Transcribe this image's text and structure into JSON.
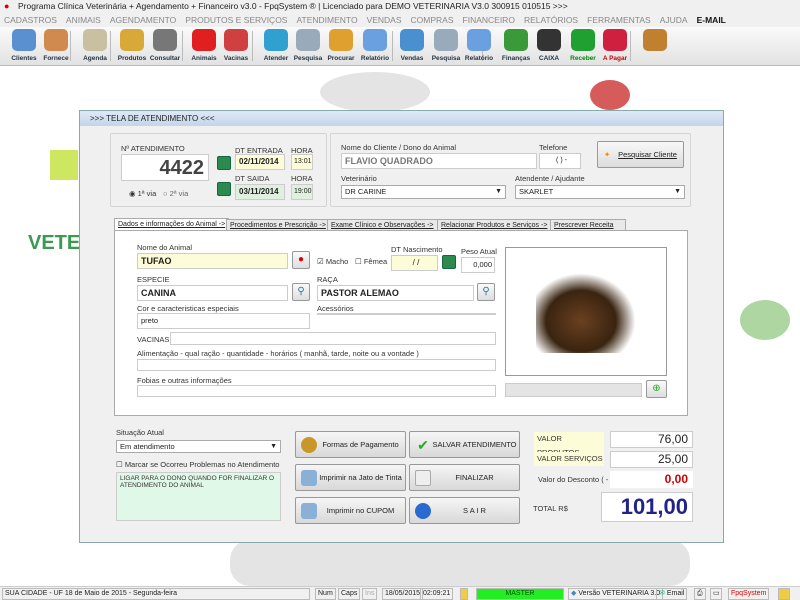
{
  "window": {
    "title": "Programa Clínica Veterinária + Agendamento + Financeiro v3.0 - FpqSystem ® | Licenciado para  DEMO VETERINARIA V3.0 300915 010515 >>>"
  },
  "menu": [
    "CADASTROS",
    "ANIMAIS",
    "AGENDAMENTO",
    "PRODUTOS E SERVIÇOS",
    "ATENDIMENTO",
    "VENDAS",
    "COMPRAS",
    "FINANCEIRO",
    "RELATÓRIOS",
    "FERRAMENTAS",
    "AJUDA",
    "E-MAIL"
  ],
  "toolbar": [
    {
      "label": "Clientes",
      "color": "#5a8fd0"
    },
    {
      "label": "Fornece",
      "color": "#d08a50"
    },
    {
      "label": "Agenda",
      "color": "#c8c0a0"
    },
    {
      "label": "Produtos",
      "color": "#d8a838"
    },
    {
      "label": "Consultar",
      "color": "#777"
    },
    {
      "label": "Animais",
      "color": "#e02020"
    },
    {
      "label": "Vacinas",
      "color": "#d04040"
    },
    {
      "label": "Atender",
      "color": "#30a0d0"
    },
    {
      "label": "Pesquisa",
      "color": "#9ab"
    },
    {
      "label": "Procurar",
      "color": "#e0a030"
    },
    {
      "label": "Relatório",
      "color": "#6aa0e0"
    },
    {
      "label": "Vendas",
      "color": "#4a90d0"
    },
    {
      "label": "Pesquisa",
      "color": "#9ab"
    },
    {
      "label": "Relatório",
      "color": "#6aa0e0"
    },
    {
      "label": "Finanças",
      "color": "#3a9a3a"
    },
    {
      "label": "CAIXA",
      "color": "#333"
    },
    {
      "label": "Receber",
      "color": "#20a030"
    },
    {
      "label": "A Pagar",
      "color": "#d02040"
    },
    {
      "label": "",
      "color": "#c08030"
    }
  ],
  "background": {
    "brand_text": "VETE"
  },
  "dialog": {
    "title": ">>>   TELA DE ATENDIMENTO   <<<",
    "atendimento": {
      "label": "Nº ATENDIMENTO",
      "value": "4422",
      "via1": "1ª via",
      "via2": "2ª via",
      "dt_entrada_label": "DT ENTRADA",
      "dt_entrada": "02/11/2014",
      "hora_label": "HORA",
      "hora_entrada": "13:01",
      "dt_saida_label": "DT SAIDA",
      "dt_saida": "03/11/2014",
      "hora_saida": "19:00"
    },
    "cliente": {
      "label": "Nome do Cliente / Dono do Animal",
      "value": "FLAVIO QUADRADO",
      "telefone_label": "Telefone",
      "telefone": "(  )    -",
      "pesquisar": "Pesquisar Cliente",
      "veterinario_label": "Veterinário",
      "veterinario": "DR CARINE",
      "atendente_label": "Atendente / Ajudante",
      "atendente": "SKARLET"
    },
    "tabs": [
      "Dados e informações do Animal ->",
      "Procedimentos e Prescrição ->",
      "Exame Clínico e Observações ->",
      "Relacionar Produtos e Serviços ->",
      "Prescrever Receita"
    ],
    "animal": {
      "nome_label": "Nome do Animal",
      "nome": "TUFAO",
      "macho": "Macho",
      "femea": "Fêmea",
      "nasc_label": "DT Nascimento",
      "nasc": "/ /",
      "peso_label": "Peso Atual",
      "peso": "0,000",
      "especie_label": "ESPECIE",
      "especie": "CANINA",
      "raca_label": "RAÇA",
      "raca": "PASTOR ALEMAO",
      "cor_label": "Cor e caracteristicas especiais",
      "cor": "preto",
      "acess_label": "Acessórios",
      "acess": "",
      "vacinas_label": "VACINAS",
      "vacinas": "",
      "alim_label": "Alimentação - qual ração - quantidade - horários ( manhã, tarde, noite ou a vontade )",
      "alim": "",
      "fobias_label": "Fobias e outras informações",
      "fobias": ""
    },
    "situacao": {
      "label": "Situação Atual",
      "value": "Em atendimento",
      "check_label": "Marcar se Ocorreu Problemas no Atendimento",
      "obs": "LIGAR PARA O DONO QUANDO FOR FINALIZAR O ATENDIMENTO DO ANIMAL"
    },
    "buttons": {
      "formas": "Formas de Pagamento",
      "salvar": "SALVAR  ATENDIMENTO",
      "jato": "Imprimir na Jato de Tinta",
      "finalizar": "FINALIZAR",
      "cupom": "Imprimir no CUPOM",
      "sair": "S A I R"
    },
    "valores": {
      "produtos_label": "VALOR PRODUTOS",
      "produtos": "76,00",
      "servicos_label": "VALOR SERVIÇOS",
      "servicos": "25,00",
      "desconto_label": "Valor do Desconto ( - )",
      "desconto": "0,00",
      "total_label": "TOTAL R$",
      "total": "101,00"
    }
  },
  "status": {
    "city": "SUA CIDADE - UF 18 de Maio de 2015 - Segunda-feira",
    "num": "Num",
    "caps": "Caps",
    "ins": "Ins",
    "date": "18/05/2015",
    "time": "02:09:21",
    "user": "MASTER",
    "version": "Versão VETERINARIA 3.0",
    "email": "Email",
    "brand": "FpqSystem"
  }
}
